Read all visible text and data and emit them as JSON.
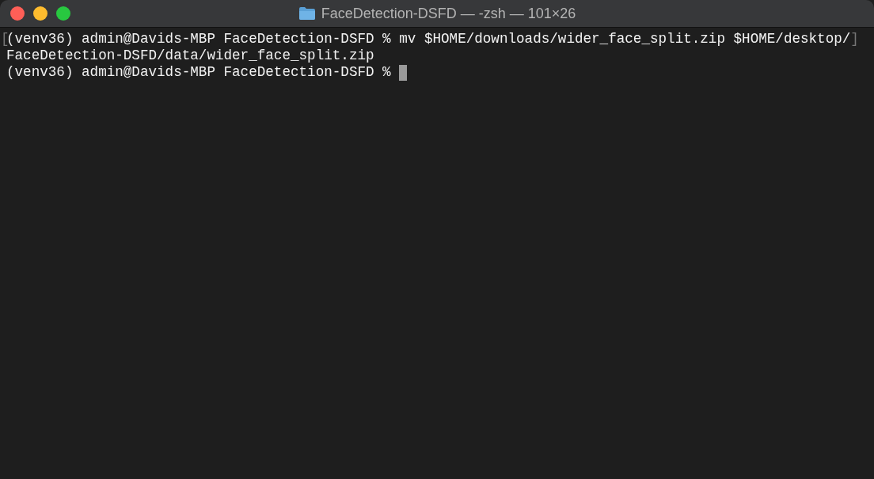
{
  "window": {
    "title": "FaceDetection-DSFD — -zsh — 101×26"
  },
  "terminal": {
    "lines": [
      {
        "mark_left": "[",
        "text": "(venv36) admin@Davids-MBP FaceDetection-DSFD % mv $HOME/downloads/wider_face_split.zip $HOME/desktop/",
        "mark_right": "]",
        "cursor": false
      },
      {
        "text": "FaceDetection-DSFD/data/wider_face_split.zip",
        "cursor": false
      },
      {
        "text": "(venv36) admin@Davids-MBP FaceDetection-DSFD % ",
        "cursor": true
      }
    ]
  }
}
